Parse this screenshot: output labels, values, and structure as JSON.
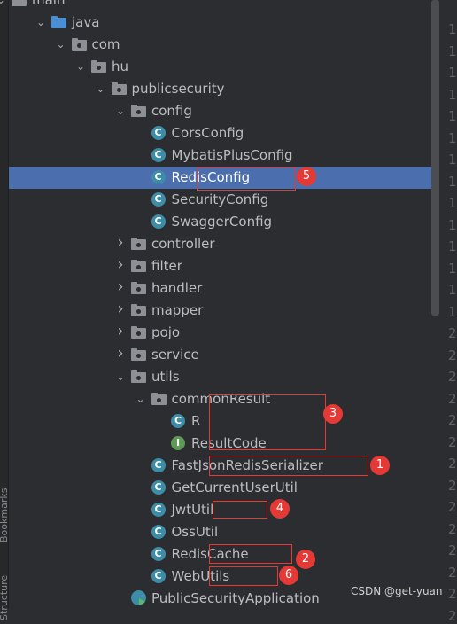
{
  "tree": {
    "nodes": [
      {
        "label": "main",
        "kind": "folder",
        "chev": "down"
      },
      {
        "label": "java",
        "kind": "folder-blue",
        "chev": "down"
      },
      {
        "label": "com",
        "kind": "package",
        "chev": "down"
      },
      {
        "label": "hu",
        "kind": "package",
        "chev": "down"
      },
      {
        "label": "publicsecurity",
        "kind": "package",
        "chev": "down"
      },
      {
        "label": "config",
        "kind": "package",
        "chev": "down"
      },
      {
        "label": "CorsConfig",
        "kind": "class",
        "chev": ""
      },
      {
        "label": "MybatisPlusConfig",
        "kind": "class",
        "chev": ""
      },
      {
        "label": "RedisConfig",
        "kind": "class",
        "chev": "",
        "selected": true
      },
      {
        "label": "SecurityConfig",
        "kind": "class",
        "chev": ""
      },
      {
        "label": "SwaggerConfig",
        "kind": "class",
        "chev": ""
      },
      {
        "label": "controller",
        "kind": "package",
        "chev": "right"
      },
      {
        "label": "filter",
        "kind": "package",
        "chev": "right"
      },
      {
        "label": "handler",
        "kind": "package",
        "chev": "right"
      },
      {
        "label": "mapper",
        "kind": "package",
        "chev": "right"
      },
      {
        "label": "pojo",
        "kind": "package",
        "chev": "right"
      },
      {
        "label": "service",
        "kind": "package",
        "chev": "right"
      },
      {
        "label": "utils",
        "kind": "package",
        "chev": "down"
      },
      {
        "label": "commonResult",
        "kind": "package",
        "chev": "down"
      },
      {
        "label": "R",
        "kind": "class",
        "chev": ""
      },
      {
        "label": "ResultCode",
        "kind": "interface",
        "chev": ""
      },
      {
        "label": "FastJsonRedisSerializer",
        "kind": "class",
        "chev": ""
      },
      {
        "label": "GetCurrentUserUtil",
        "kind": "class",
        "chev": ""
      },
      {
        "label": "JwtUtil",
        "kind": "class",
        "chev": ""
      },
      {
        "label": "OssUtil",
        "kind": "class",
        "chev": ""
      },
      {
        "label": "RedisCache",
        "kind": "class",
        "chev": ""
      },
      {
        "label": "WebUtils",
        "kind": "class",
        "chev": ""
      },
      {
        "label": "PublicSecurityApplication",
        "kind": "app",
        "chev": ""
      }
    ]
  },
  "icons": {
    "class_letter": "C",
    "interface_letter": "I"
  },
  "badges": [
    "5",
    "3",
    "1",
    "4",
    "2",
    "6"
  ],
  "gutter_numbers": [
    "1",
    "1",
    "1",
    "1",
    "1",
    "1",
    "1",
    "1",
    "1",
    "1",
    "1",
    "1",
    "1",
    "1",
    "2",
    "2",
    "2",
    "2",
    "2",
    "2",
    "2",
    "2",
    "2",
    "2",
    "2",
    "2",
    "2",
    "2"
  ],
  "side_labels": {
    "bookmarks": "Bookmarks",
    "structure": "Structure"
  },
  "watermark": "CSDN @get-yuan",
  "colors": {
    "selection": "#4b6eaf",
    "annotation": "#e53935",
    "class_icon": "#3d8ca8",
    "interface_icon": "#5e9955"
  }
}
